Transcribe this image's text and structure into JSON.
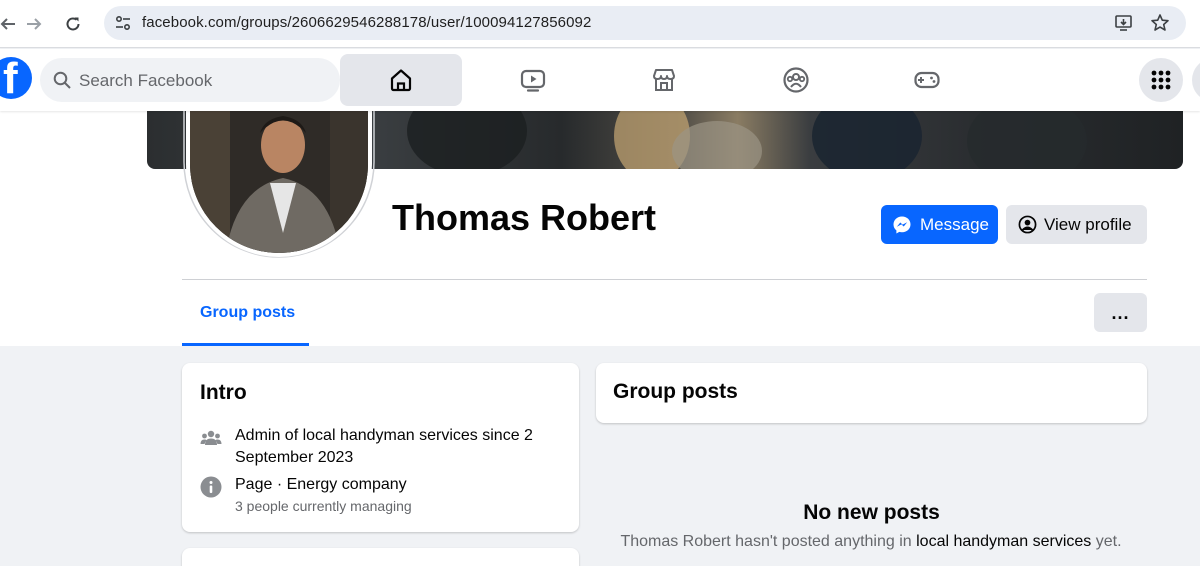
{
  "browser": {
    "url": "facebook.com/groups/2606629546288178/user/100094127856092",
    "back_icon": "arrow-left-icon",
    "forward_icon": "arrow-right-icon",
    "reload_icon": "reload-icon"
  },
  "fb_header": {
    "logo_letter": "f",
    "search_placeholder": "Search Facebook",
    "tabs": [
      "home-icon",
      "video-icon",
      "marketplace-icon",
      "groups-icon",
      "gaming-icon"
    ],
    "active_tab": "home-icon",
    "brand_color": "#0866ff"
  },
  "profile": {
    "name": "Thomas Robert",
    "message_button": "Message",
    "view_profile_button": "View profile",
    "tabs": [
      {
        "label": "Group posts",
        "active": true
      }
    ],
    "more_button": "..."
  },
  "intro": {
    "title": "Intro",
    "admin_prefix": "Admin of ",
    "admin_group": "local handyman services",
    "admin_suffix": " since 2 September 2023",
    "page_label": "Page",
    "page_category": " · Energy company",
    "managing": "3 people currently managing"
  },
  "group_posts": {
    "title": "Group posts",
    "empty_title": "No new posts",
    "empty_prefix": "Thomas Robert hasn't posted anything in ",
    "empty_group": "local handyman services",
    "empty_suffix": " yet."
  }
}
